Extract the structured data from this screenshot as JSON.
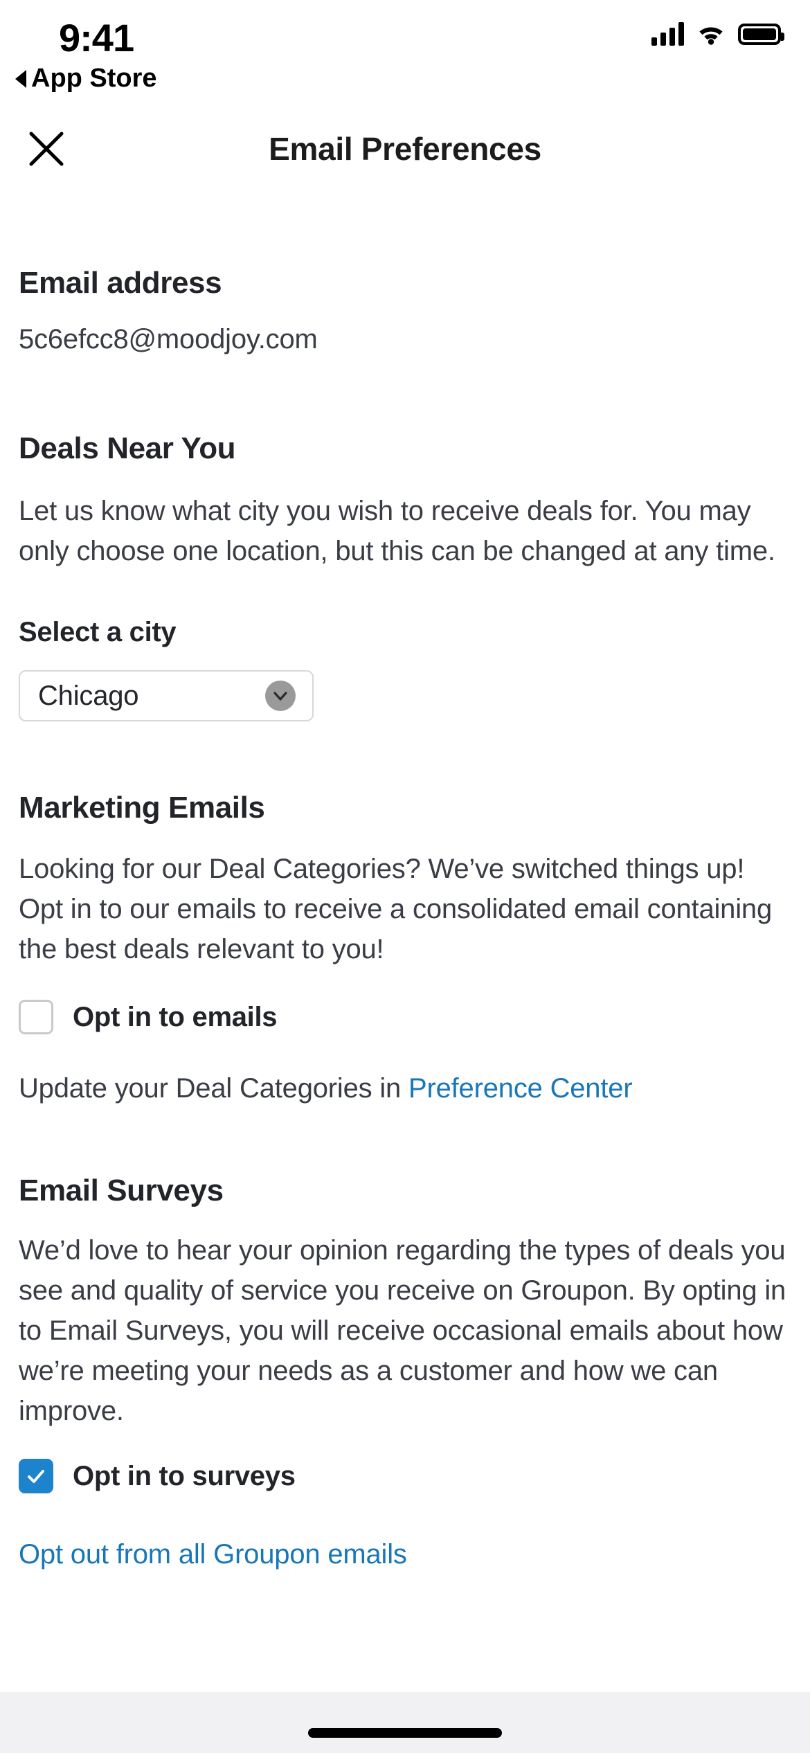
{
  "status_bar": {
    "time": "9:41",
    "back_label": "App Store",
    "icons": {
      "signal": "cellular-signal-icon",
      "wifi": "wifi-icon",
      "battery": "battery-icon"
    }
  },
  "navbar": {
    "close_icon": "close-icon",
    "title": "Email Preferences"
  },
  "email_section": {
    "title": "Email address",
    "value": "5c6efcc8@moodjoy.com"
  },
  "deals_section": {
    "title": "Deals Near You",
    "body": "Let us know what city you wish to receive deals for. You may only choose one location, but this can be changed at any time.",
    "city_label": "Select a city",
    "city_selected": "Chicago",
    "chevron_icon": "chevron-down-icon"
  },
  "marketing_section": {
    "title": "Marketing Emails",
    "body": "Looking for our Deal Categories? We’ve switched things up! Opt in to our emails to receive a consolidated email containing the best deals relevant to you!",
    "checkbox_label": "Opt in to emails",
    "checkbox_checked": false,
    "pref_prefix": "Update your Deal Categories in ",
    "pref_link": "Preference Center"
  },
  "surveys_section": {
    "title": "Email Surveys",
    "body": "We’d love to hear your opinion regarding the types of deals you see and quality of service you receive on Groupon. By opting in to Email Surveys, you will receive occasional emails about how we’re meeting your needs as a customer and how we can improve.",
    "checkbox_label": "Opt in to surveys",
    "checkbox_checked": true
  },
  "footer": {
    "optout_link": "Opt out from all Groupon emails"
  },
  "colors": {
    "link_blue": "#1877b8",
    "checkbox_blue": "#1d83cc",
    "text_primary": "#22242a",
    "text_body": "#3a3d45",
    "border_gray": "#d6d8db",
    "home_bar_bg": "#f1f1f3"
  }
}
